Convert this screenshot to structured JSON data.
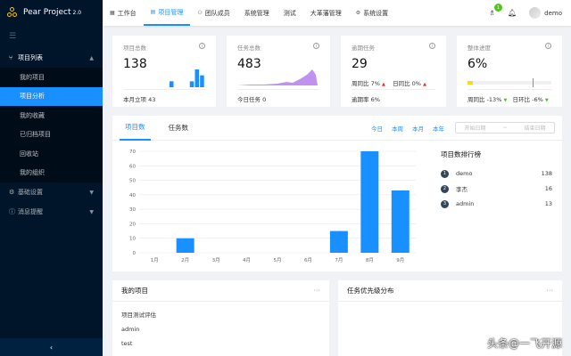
{
  "app": {
    "name": "Pear Project",
    "version": "2.0"
  },
  "sidebar": {
    "groups": [
      {
        "icon": "branch-icon",
        "label": "项目列表",
        "expanded": true,
        "items": [
          "我的项目",
          "项目分析",
          "我的收藏",
          "已归档项目",
          "回收站",
          "我的组织"
        ],
        "active_index": 1
      },
      {
        "icon": "settings-icon",
        "label": "基础设置"
      },
      {
        "icon": "info-icon",
        "label": "消息提醒"
      }
    ],
    "collapse_glyph": "‹"
  },
  "header": {
    "nav": [
      {
        "icon": "grid-icon",
        "label": "工作台"
      },
      {
        "icon": "chart-icon",
        "label": "项目管理"
      },
      {
        "icon": "team-icon",
        "label": "团队成员"
      },
      {
        "label": "系统管理"
      },
      {
        "label": "测试"
      },
      {
        "label": "大革藩管理"
      },
      {
        "icon": "gear-icon",
        "label": "系统设置"
      }
    ],
    "active_nav_index": 1,
    "notification_count": "1",
    "username": "demo"
  },
  "stats": {
    "projects": {
      "label": "项目总数",
      "value": "138",
      "footer": "本月立项 43",
      "bars": [
        1,
        0,
        0,
        0,
        1,
        3,
        2
      ]
    },
    "tasks": {
      "label": "任务总数",
      "value": "483",
      "footer": "今日任务 0"
    },
    "overdue": {
      "label": "逾期任务",
      "value": "29",
      "week_label": "周同比",
      "week_value": "7%",
      "day_label": "日同比",
      "day_value": "0%",
      "footer": "逾期率 6%"
    },
    "progress": {
      "label": "整体进度",
      "value": "6%",
      "progress_fraction": 0.06,
      "week_label": "周同比",
      "week_value": "-13%",
      "day_label": "日环比",
      "day_value": "-6%"
    }
  },
  "chart_panel": {
    "tabs": [
      "项目数",
      "任务数"
    ],
    "active_tab": 0,
    "ranges": [
      "今日",
      "本周",
      "本月",
      "本年"
    ],
    "date_start": "开始日期",
    "date_sep": "~",
    "date_end": "结束日期",
    "ranking": {
      "title": "项目数排行榜",
      "rows": [
        {
          "rank": "1",
          "name": "demo",
          "count": "138"
        },
        {
          "rank": "2",
          "name": "李杰",
          "count": "16"
        },
        {
          "rank": "3",
          "name": "admin",
          "count": "13"
        }
      ]
    }
  },
  "chart_data": {
    "type": "bar",
    "categories": [
      "1月",
      "2月",
      "3月",
      "4月",
      "5月",
      "6月",
      "7月",
      "8月",
      "9月"
    ],
    "values": [
      0,
      10,
      0,
      0,
      0,
      0,
      15,
      70,
      43
    ],
    "yticks": [
      0,
      10,
      20,
      30,
      40,
      50,
      60,
      70
    ],
    "ylim": [
      0,
      70
    ],
    "grid": true,
    "bar_color": "#1890ff"
  },
  "bottom": {
    "my_projects": {
      "title": "我的项目",
      "more": "···",
      "items": [
        "项目测试评估",
        "admin",
        "test"
      ]
    },
    "priority": {
      "title": "任务优先级分布",
      "more": "···"
    }
  },
  "watermark": "头条@一飞开源",
  "colors": {
    "primary": "#1890ff",
    "sidebar_bg": "#001529",
    "mini_area": "#b37feb"
  }
}
